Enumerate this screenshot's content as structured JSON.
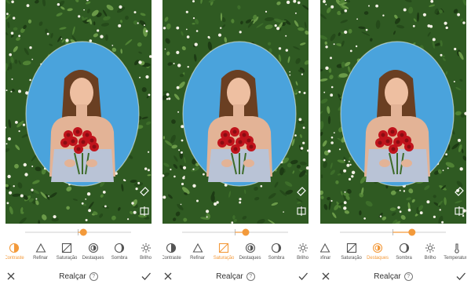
{
  "colors": {
    "accent": "#f39a3b",
    "sky": "#4aa3dc",
    "foliage": "#2f5a22",
    "rose": "#c0141c"
  },
  "panels": [
    {
      "tools": [
        {
          "icon": "contrast-icon",
          "label": "Contraste",
          "active": true
        },
        {
          "icon": "refine-triangle-icon",
          "label": "Refinar",
          "active": false
        },
        {
          "icon": "saturation-icon",
          "label": "Saturação",
          "active": false
        },
        {
          "icon": "highlights-icon",
          "label": "Destaques",
          "active": false
        },
        {
          "icon": "shadow-icon",
          "label": "Sombra",
          "active": false
        },
        {
          "icon": "brightness-icon",
          "label": "Brilho",
          "active": false
        }
      ],
      "slider_value": 0.55,
      "bottom": {
        "title": "Realçar",
        "help": "?"
      }
    },
    {
      "tools": [
        {
          "icon": "contrast-icon",
          "label": "Contraste",
          "active": false
        },
        {
          "icon": "refine-triangle-icon",
          "label": "Refinar",
          "active": false
        },
        {
          "icon": "saturation-icon",
          "label": "Saturação",
          "active": true
        },
        {
          "icon": "highlights-icon",
          "label": "Destaques",
          "active": false
        },
        {
          "icon": "shadow-icon",
          "label": "Sombra",
          "active": false
        },
        {
          "icon": "brightness-icon",
          "label": "Brilho",
          "active": false
        }
      ],
      "slider_value": 0.6,
      "bottom": {
        "title": "Realçar",
        "help": "?"
      }
    },
    {
      "tools": [
        {
          "icon": "refine-triangle-icon",
          "label": "efinar",
          "active": false
        },
        {
          "icon": "saturation-icon",
          "label": "Saturação",
          "active": false
        },
        {
          "icon": "highlights-icon",
          "label": "Destaques",
          "active": true
        },
        {
          "icon": "shadow-icon",
          "label": "Sombra",
          "active": false
        },
        {
          "icon": "brightness-icon",
          "label": "Brilho",
          "active": false
        },
        {
          "icon": "thermometer-icon",
          "label": "Temperatura",
          "active": false
        },
        {
          "icon": "tint-icon",
          "label": "A",
          "active": false
        }
      ],
      "slider_value": 0.68,
      "bottom": {
        "title": "Realçar",
        "help": "?"
      }
    }
  ]
}
